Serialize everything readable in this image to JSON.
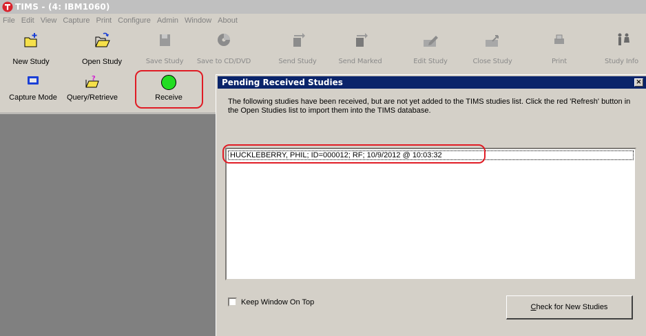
{
  "window": {
    "title": "TIMS - (4: IBM1060)"
  },
  "menu": [
    "File",
    "Edit",
    "View",
    "Capture",
    "Print",
    "Configure",
    "Admin",
    "Window",
    "About"
  ],
  "toolbar": {
    "row1": [
      {
        "label": "New Study",
        "icon": "new-study-icon",
        "enabled": true
      },
      {
        "label": "Open Study",
        "icon": "open-folder-icon",
        "enabled": true
      },
      {
        "label": "Save Study",
        "icon": "save-study-icon",
        "enabled": false
      },
      {
        "label": "Save to CD/DVD",
        "icon": "cd-icon",
        "enabled": false
      },
      {
        "label": "Send Study",
        "icon": "send-study-icon",
        "enabled": false
      },
      {
        "label": "Send Marked",
        "icon": "send-marked-icon",
        "enabled": false
      },
      {
        "label": "Edit Study",
        "icon": "edit-study-icon",
        "enabled": false
      },
      {
        "label": "Close Study",
        "icon": "close-study-icon",
        "enabled": false
      },
      {
        "label": "Print",
        "icon": "printer-icon",
        "enabled": false
      },
      {
        "label": "Study Info",
        "icon": "study-info-icon",
        "enabled": false
      }
    ],
    "row2": [
      {
        "label": "Capture Mode",
        "icon": "capture-mode-icon"
      },
      {
        "label": "Query/Retrieve",
        "icon": "query-retrieve-icon"
      },
      {
        "label": "Receive",
        "icon": "green-circle-icon"
      }
    ]
  },
  "dialog": {
    "title": "Pending Received Studies",
    "close_glyph": "×",
    "message": "The following studies have been received, but are not yet added to the TIMS studies list.  Click the red 'Refresh' button in the Open Studies list to import them into the TIMS database.",
    "studies": [
      "HUCKLEBERRY, PHIL; ID=000012; RF; 10/9/2012 @ 10:03:32"
    ],
    "keep_on_top_label": "Keep Window On Top",
    "keep_on_top_checked": false,
    "check_button_label": "Check for New Studies"
  },
  "colors": {
    "highlight": "#e01b24",
    "dialog_title_bg": "#0a246a",
    "receive_green": "#22dd22"
  }
}
